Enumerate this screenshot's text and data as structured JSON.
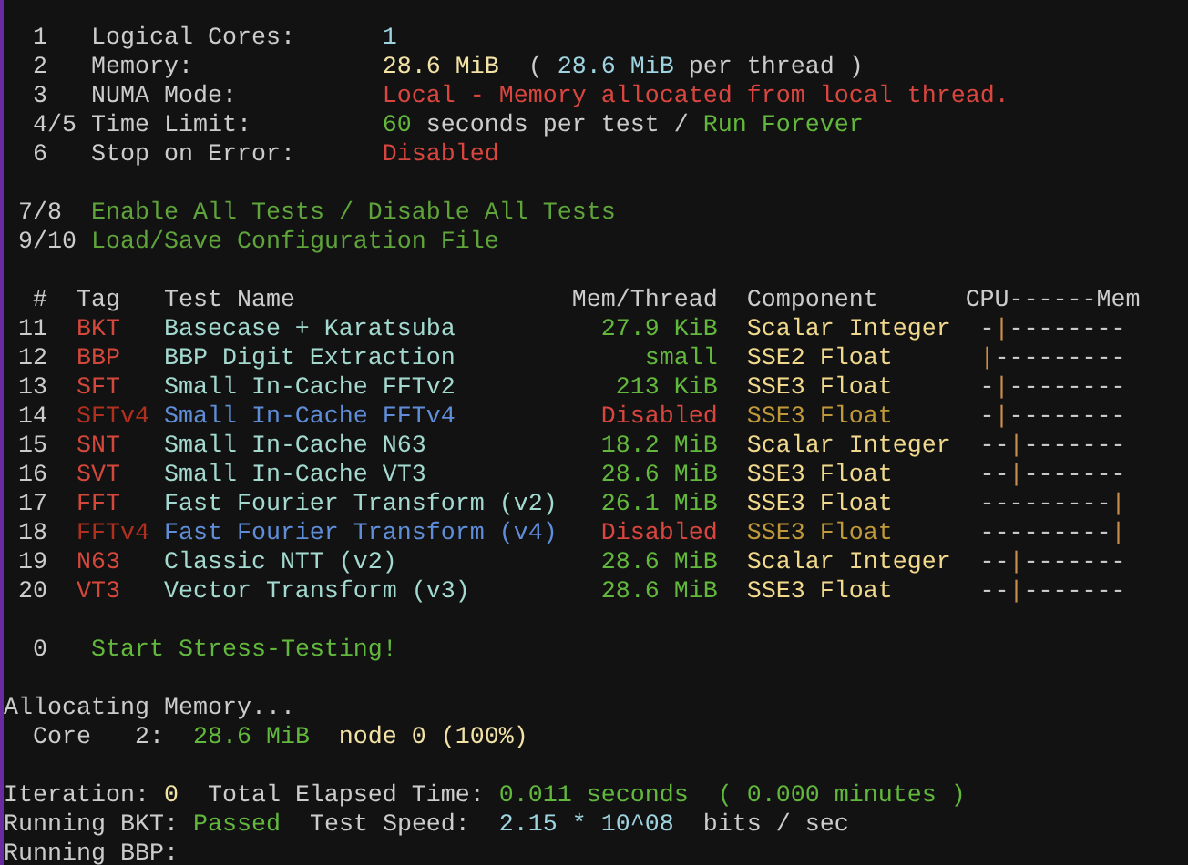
{
  "settings": [
    {
      "key": "1",
      "label": "Logical Cores:",
      "value": [
        {
          "kind": "number",
          "text": "1"
        }
      ]
    },
    {
      "key": "2",
      "label": "Memory:",
      "value": [
        {
          "kind": "amount",
          "text": "28.6 MiB"
        },
        {
          "kind": "plain",
          "text": " ("
        },
        {
          "kind": "number",
          "text": "28.6 MiB"
        },
        {
          "kind": "plain",
          "text": "per thread )"
        }
      ]
    },
    {
      "key": "3",
      "label": "NUMA Mode:",
      "value": [
        {
          "kind": "error",
          "text": "Local - Memory allocated from local thread."
        }
      ]
    },
    {
      "key": "4/5",
      "label": "Time Limit:",
      "value": [
        {
          "kind": "good",
          "text": "60"
        },
        {
          "kind": "plain",
          "text": "seconds per test /"
        },
        {
          "kind": "good",
          "text": "Run Forever"
        }
      ]
    },
    {
      "key": "6",
      "label": "Stop on Error:",
      "value": [
        {
          "kind": "error",
          "text": "Disabled"
        }
      ]
    }
  ],
  "actions": [
    {
      "key": "7/8",
      "label": "Enable All Tests / Disable All Tests"
    },
    {
      "key": "9/10",
      "label": "Load/Save Configuration File"
    }
  ],
  "table": {
    "columns": [
      "#",
      "Tag",
      "Test Name",
      "Mem/Thread",
      "Component",
      "CPU------Mem"
    ],
    "rows": [
      {
        "num": "11",
        "tag": "BKT",
        "name": "Basecase + Karatsuba",
        "mem": "27.9 KiB",
        "component": "Scalar Integer",
        "gauge": "-|--------",
        "level": 0.111,
        "enabled": true
      },
      {
        "num": "12",
        "tag": "BBP",
        "name": "BBP Digit Extraction",
        "mem": "small",
        "component": "SSE2 Float",
        "gauge": "|---------",
        "level": 0,
        "enabled": true
      },
      {
        "num": "13",
        "tag": "SFT",
        "name": "Small In-Cache FFTv2",
        "mem": "213 KiB",
        "component": "SSE3 Float",
        "gauge": "-|--------",
        "level": 0.111,
        "enabled": true
      },
      {
        "num": "14",
        "tag": "SFTv4",
        "name": "Small In-Cache FFTv4",
        "mem": "Disabled",
        "component": "SSE3 Float",
        "gauge": "-|--------",
        "level": 0.111,
        "enabled": false
      },
      {
        "num": "15",
        "tag": "SNT",
        "name": "Small In-Cache N63",
        "mem": "18.2 MiB",
        "component": "Scalar Integer",
        "gauge": "--|-------",
        "level": 0.222,
        "enabled": true
      },
      {
        "num": "16",
        "tag": "SVT",
        "name": "Small In-Cache VT3",
        "mem": "28.6 MiB",
        "component": "SSE3 Float",
        "gauge": "--|-------",
        "level": 0.222,
        "enabled": true
      },
      {
        "num": "17",
        "tag": "FFT",
        "name": "Fast Fourier Transform (v2)",
        "mem": "26.1 MiB",
        "component": "SSE3 Float",
        "gauge": "---------|",
        "level": 1,
        "enabled": true
      },
      {
        "num": "18",
        "tag": "FFTv4",
        "name": "Fast Fourier Transform (v4)",
        "mem": "Disabled",
        "component": "SSE3 Float",
        "gauge": "---------|",
        "level": 1,
        "enabled": false
      },
      {
        "num": "19",
        "tag": "N63",
        "name": "Classic NTT (v2)",
        "mem": "28.6 MiB",
        "component": "Scalar Integer",
        "gauge": "--|-------",
        "level": 0.222,
        "enabled": true
      },
      {
        "num": "20",
        "tag": "VT3",
        "name": "Vector Transform (v3)",
        "mem": "28.6 MiB",
        "component": "SSE3 Float",
        "gauge": "--|-------",
        "level": 0.222,
        "enabled": true
      }
    ]
  },
  "start": {
    "key": "0",
    "label": "Start Stress-Testing!"
  },
  "log": [
    {
      "lines": [
        {
          "segments": [
            {
              "kind": "plain",
              "text": "Allocating Memory..."
            }
          ]
        },
        {
          "segments": [
            {
              "kind": "plain",
              "text": "  Core   2:"
            },
            {
              "kind": "good",
              "text": " 28.6 MiB"
            },
            {
              "kind": "amount",
              "text": " node 0 (100%)"
            }
          ]
        }
      ]
    },
    {
      "lines": [
        {
          "segments": [
            {
              "kind": "plain",
              "text": "Iteration:"
            },
            {
              "kind": "amount",
              "text": "0"
            },
            {
              "kind": "plain",
              "text": " Total Elapsed Time:"
            },
            {
              "kind": "good",
              "text": "0.011 seconds  ( 0.000 minutes )"
            }
          ]
        },
        {
          "segments": [
            {
              "kind": "plain",
              "text": "Running BKT:"
            },
            {
              "kind": "good",
              "text": "Passed"
            },
            {
              "kind": "plain",
              "text": " Test Speed: "
            },
            {
              "kind": "number",
              "text": "2.15 * 10^08"
            },
            {
              "kind": "plain",
              "text": " bits / sec"
            }
          ]
        },
        {
          "segments": [
            {
              "kind": "plain",
              "text": "Running BBP:"
            }
          ]
        }
      ]
    }
  ]
}
